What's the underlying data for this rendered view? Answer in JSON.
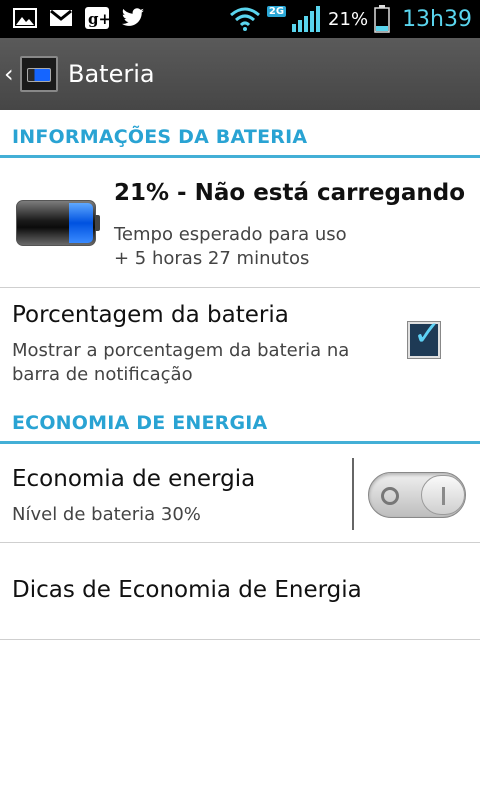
{
  "status_bar": {
    "battery_percent": "21%",
    "time": "13h39",
    "network_badge": "2G",
    "icons": [
      "image-icon",
      "gmail-icon",
      "google-plus-icon",
      "twitter-icon",
      "wifi-icon",
      "signal-icon",
      "battery-icon"
    ]
  },
  "action_bar": {
    "title": "Bateria"
  },
  "sections": {
    "battery_info": "INFORMAÇÕES DA BATERIA",
    "energy_saving": "ECONOMIA DE ENERGIA"
  },
  "battery": {
    "level": 0.21,
    "status_line": "21% - Não está carregando",
    "expected_label": "Tempo esperado para uso",
    "expected_value": "+ 5 horas 27 minutos"
  },
  "percentage_setting": {
    "title": "Porcentagem da bateria",
    "description_line1": "Mostrar a porcentagem da bateria na",
    "description_line2": "barra de notificação",
    "checked": true
  },
  "power_saving": {
    "title": "Economia de energia",
    "subtitle": "Nível de bateria 30%",
    "enabled": false
  },
  "tips": {
    "title": "Dicas de Economia de Energia"
  },
  "colors": {
    "accent": "#29a3d3",
    "battery_fill": "#0052e0"
  }
}
